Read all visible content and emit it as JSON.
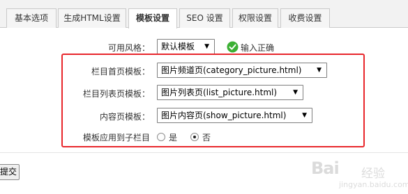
{
  "tabs": [
    {
      "label": "基本选项",
      "active": false
    },
    {
      "label": "生成HTML设置",
      "active": false
    },
    {
      "label": "模板设置",
      "active": true
    },
    {
      "label": "SEO 设置",
      "active": false
    },
    {
      "label": "权限设置",
      "active": false
    },
    {
      "label": "收费设置",
      "active": false
    }
  ],
  "form": {
    "style": {
      "label": "可用风格：",
      "value": "默认模板",
      "status": "输入正确"
    },
    "category_template": {
      "label": "栏目首页模板：",
      "value": "图片频道页(category_picture.html)"
    },
    "list_template": {
      "label": "栏目列表页模板：",
      "value": "图片列表页(list_picture.html)"
    },
    "show_template": {
      "label": "内容页模板：",
      "value": "图片内容页(show_picture.html)"
    },
    "apply_to_children": {
      "label": "模板应用到子栏目",
      "options": [
        {
          "label": "是",
          "checked": false
        },
        {
          "label": "否",
          "checked": true
        }
      ]
    }
  },
  "submit_label": "提交",
  "watermark": {
    "logo": "Bai",
    "sub": "经验",
    "url": "jingyan.baidu.com"
  },
  "colors": {
    "highlight": "#e8262b",
    "ok_green": "#3cb034"
  }
}
